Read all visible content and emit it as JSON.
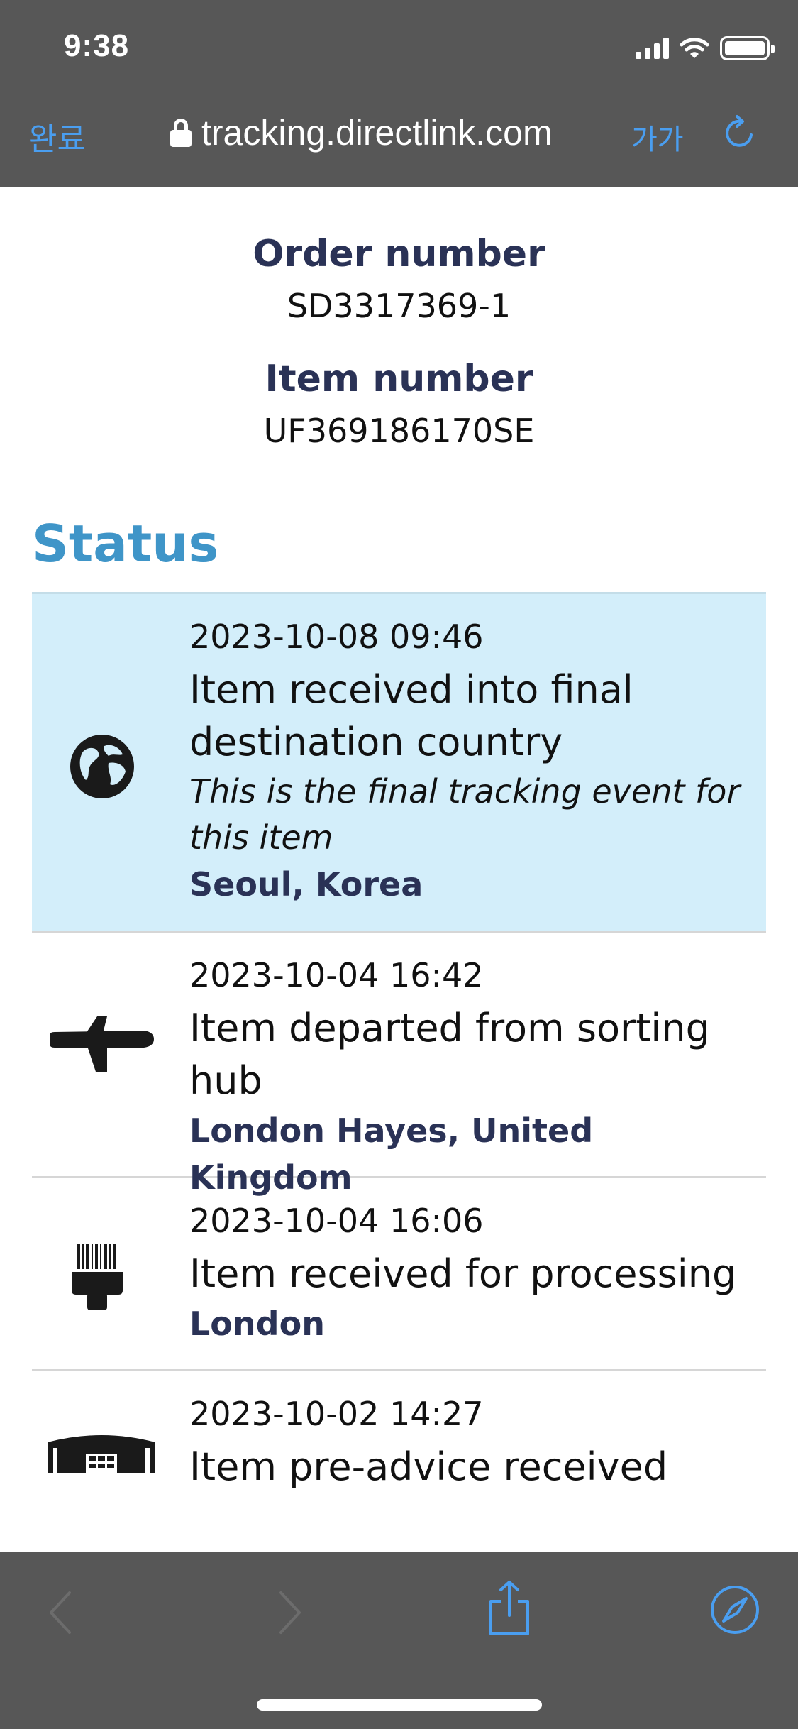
{
  "status_bar": {
    "time": "9:38",
    "icons": [
      "cellular-signal-icon",
      "wifi-icon",
      "battery-icon"
    ]
  },
  "browser": {
    "done_label": "완료",
    "url": "tracking.directlink.com",
    "text_size_label": "가가",
    "accent_color": "#4a9ef0",
    "chrome_color": "#575757"
  },
  "page": {
    "order_label": "Order number",
    "order_value": "SD3317369-1",
    "item_label": "Item number",
    "item_value": "UF369186170SE",
    "status_heading": "Status",
    "heading_color": "#3f95c8",
    "label_color": "#2a3256",
    "highlight_color": "#d3eefa",
    "events": [
      {
        "icon": "globe-icon",
        "date": "2023-10-08 09:46",
        "description_line1": "Item received into final",
        "description_line2": "destination country",
        "note_line1": "This is the final tracking event for",
        "note_line2": "this item",
        "location": "Seoul, Korea",
        "highlighted": true
      },
      {
        "icon": "airplane-icon",
        "date": "2023-10-04 16:42",
        "description_line1": "Item departed from sorting",
        "description_line2": "hub",
        "location": "London Hayes, United Kingdom"
      },
      {
        "icon": "barcode-scanner-icon",
        "date": "2023-10-04 16:06",
        "description_line1": "Item received for processing",
        "location": "London"
      },
      {
        "icon": "warehouse-icon",
        "date": "2023-10-02 14:27",
        "description_line1": "Item pre-advice received"
      }
    ]
  },
  "toolbar": {
    "icons": [
      "back-icon",
      "forward-icon",
      "share-icon",
      "compass-icon"
    ]
  }
}
